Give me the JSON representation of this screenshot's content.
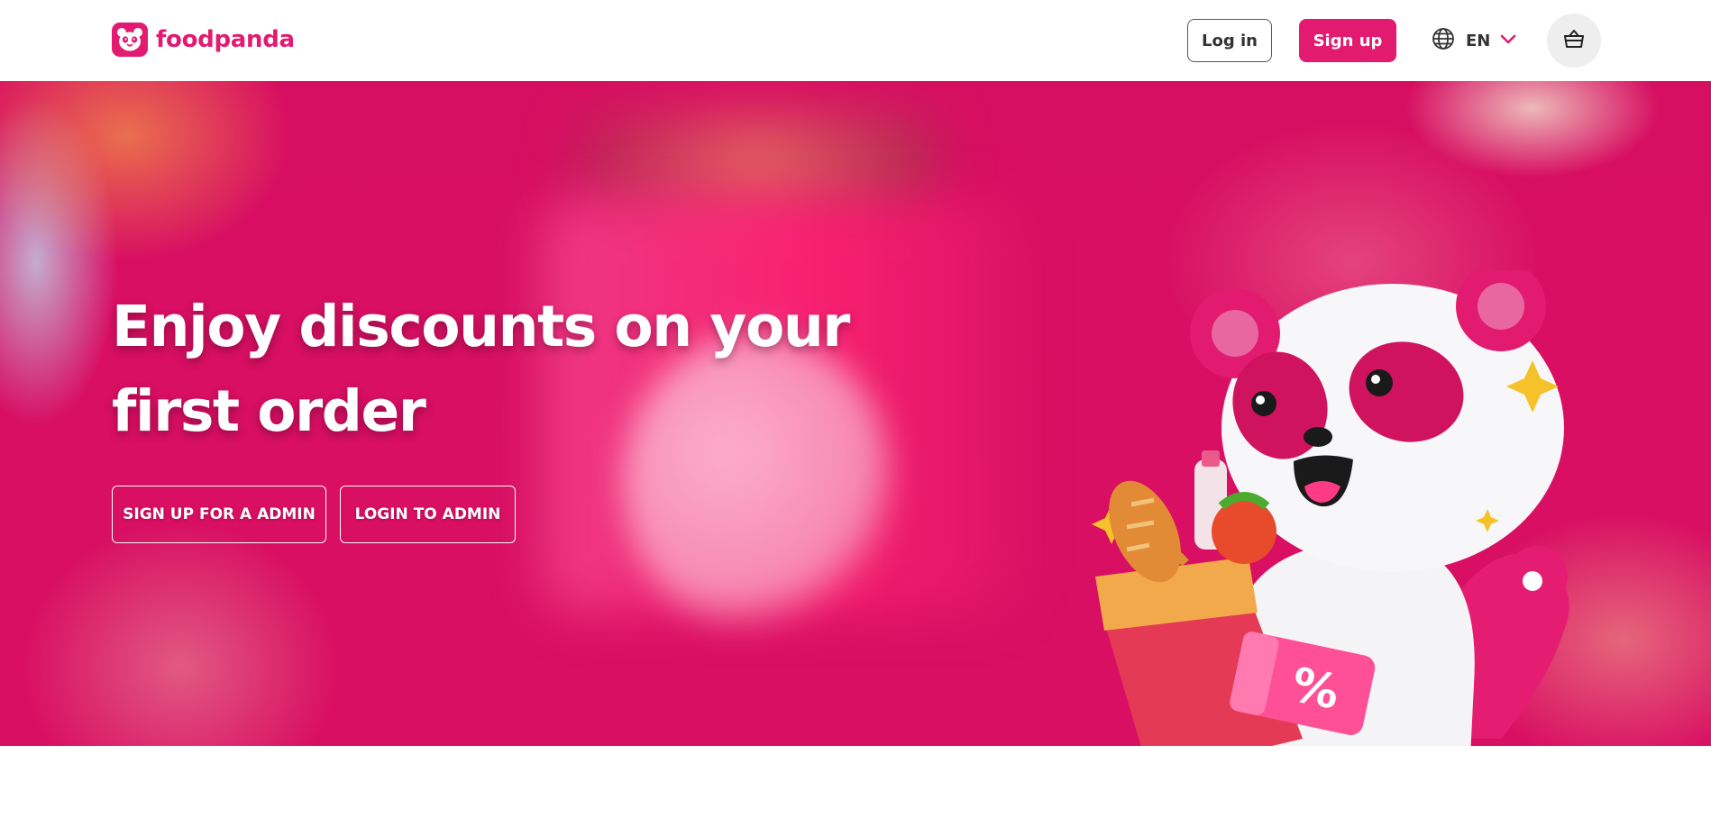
{
  "brand": {
    "name": "foodpanda",
    "color": "#e21b70"
  },
  "header": {
    "login_label": "Log in",
    "signup_label": "Sign up",
    "language_code": "EN",
    "icons": {
      "language": "globe-icon",
      "dropdown": "chevron-down-icon",
      "cart": "shopping-basket-icon"
    }
  },
  "hero": {
    "title": "Enjoy discounts on your first order",
    "buttons": {
      "signup_admin": "SIGN UP FOR A ADMIN",
      "login_admin": "LOGIN TO ADMIN"
    },
    "background_color": "#d70f62",
    "mascot_badge": "%"
  }
}
